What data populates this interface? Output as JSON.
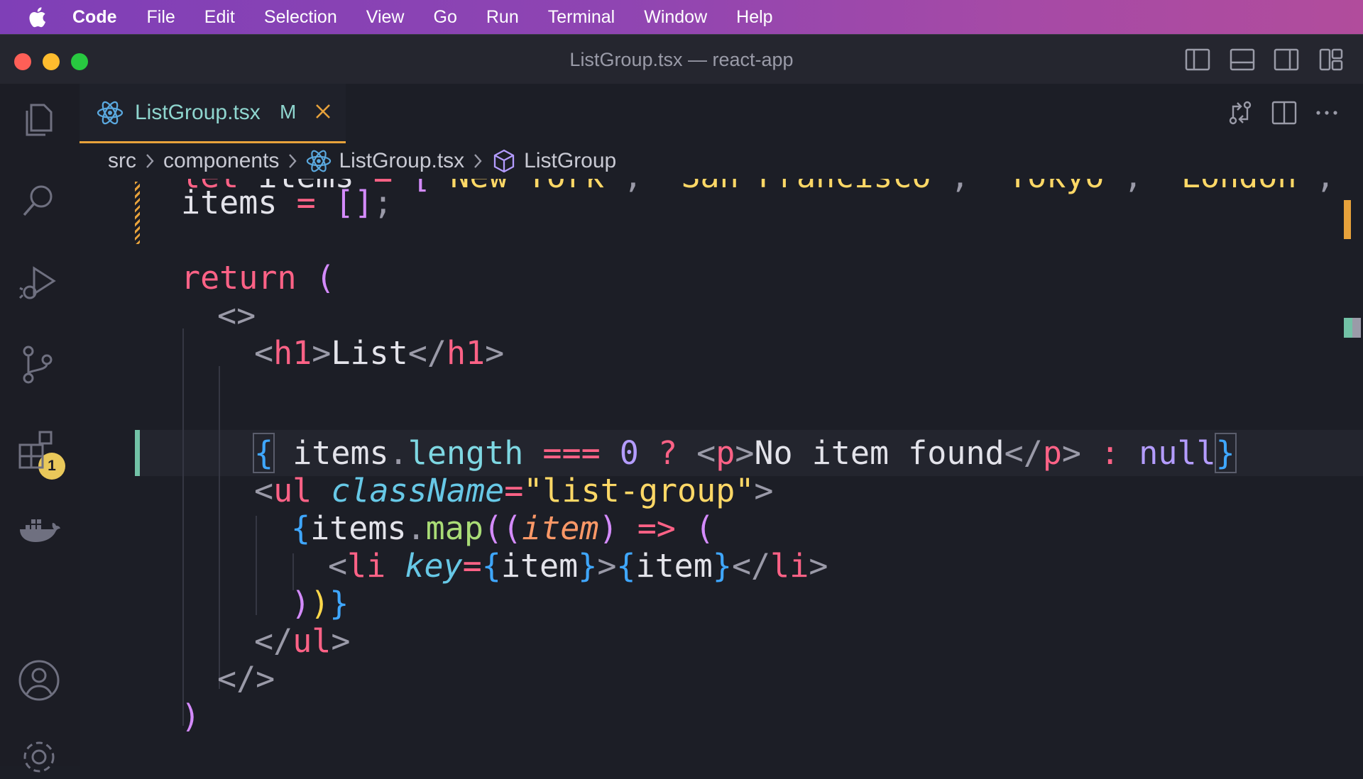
{
  "menubar": {
    "app": "Code",
    "items": [
      "File",
      "Edit",
      "Selection",
      "View",
      "Go",
      "Run",
      "Terminal",
      "Window",
      "Help"
    ]
  },
  "window": {
    "title": "ListGroup.tsx — react-app"
  },
  "activity": {
    "source_control_badge": "1"
  },
  "tab": {
    "name": "ListGroup.tsx",
    "status": "M"
  },
  "breadcrumb": {
    "items": [
      "src",
      "components",
      "ListGroup.tsx",
      "ListGroup"
    ]
  },
  "editor": {
    "language": "tsx",
    "lines": [
      "let items = [\"New York\", \"San Francisco\", \"Tokyo\", \"London\", \"Pa",
      "items = [];",
      "",
      "return (",
      "<>",
      "<h1>List</h1>",
      "{ items.length === 0 ? <p>No item found</p> : null}",
      "<ul className=\"list-group\">",
      "{items.map((item) => (",
      "<li key={item}>{item}</li>",
      "))}",
      "</ul>",
      "</>",
      ")"
    ]
  },
  "colors": {
    "menubar_gradient": [
      "#7f3fb7",
      "#b14c9c"
    ],
    "editor_bg": "#1c1e26",
    "keyword": "#ff6286",
    "string": "#ffd866",
    "property": "#7ed7e2",
    "number": "#b49cff",
    "tab_text": "#8fd6cf",
    "badge": "#e9c85a"
  }
}
